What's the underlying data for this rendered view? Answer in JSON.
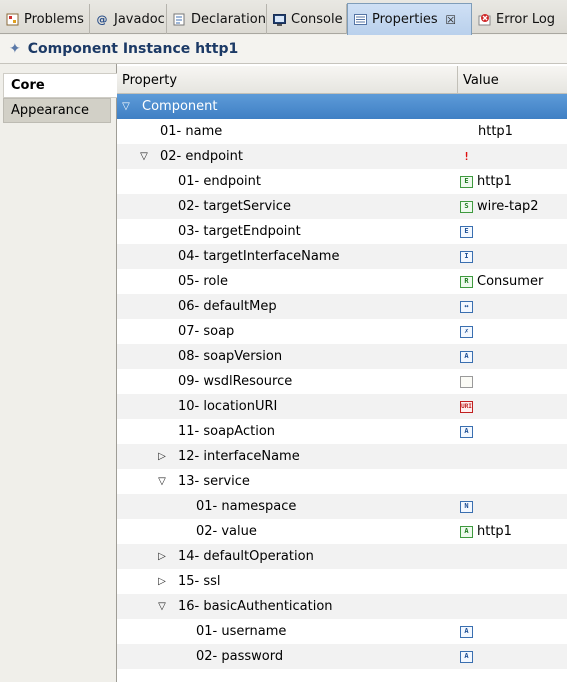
{
  "tabs": [
    {
      "label": "Problems",
      "icon": "problems-icon",
      "active": false
    },
    {
      "label": "Javadoc",
      "icon": "javadoc-icon",
      "active": false
    },
    {
      "label": "Declaration",
      "icon": "declaration-icon",
      "active": false
    },
    {
      "label": "Console",
      "icon": "console-icon",
      "active": false
    },
    {
      "label": "Properties",
      "icon": "properties-icon",
      "active": true
    },
    {
      "label": "Error Log",
      "icon": "error-log-icon",
      "active": false
    }
  ],
  "title": "Component Instance http1",
  "categories": [
    "Core",
    "Appearance"
  ],
  "columns": {
    "property": "Property",
    "value": "Value"
  },
  "rows": [
    {
      "label": "Component",
      "value": "",
      "icon": ""
    },
    {
      "label": "01- name",
      "value": "http1",
      "icon": ""
    },
    {
      "label": "02- endpoint",
      "value": "",
      "icon": "error-marker-icon"
    },
    {
      "label": "01- endpoint",
      "value": "http1",
      "icon": "endpoint-ref-icon"
    },
    {
      "label": "02- targetService",
      "value": "wire-tap2",
      "icon": "service-ref-icon"
    },
    {
      "label": "03- targetEndpoint",
      "value": "",
      "icon": "endpoint-ref-icon"
    },
    {
      "label": "04- targetInterfaceName",
      "value": "",
      "icon": "interface-icon"
    },
    {
      "label": "05- role",
      "value": "Consumer",
      "icon": "role-icon"
    },
    {
      "label": "06- defaultMep",
      "value": "",
      "icon": "mep-icon"
    },
    {
      "label": "07- soap",
      "value": "",
      "icon": "boolean-icon"
    },
    {
      "label": "08- soapVersion",
      "value": "",
      "icon": "text-attribute-icon"
    },
    {
      "label": "09- wsdlResource",
      "value": "",
      "icon": "document-icon"
    },
    {
      "label": "10- locationURI",
      "value": "",
      "icon": "uri-icon"
    },
    {
      "label": "11- soapAction",
      "value": "",
      "icon": "text-attribute-icon"
    },
    {
      "label": "12- interfaceName",
      "value": "",
      "icon": ""
    },
    {
      "label": "13- service",
      "value": "",
      "icon": ""
    },
    {
      "label": "01- namespace",
      "value": "",
      "icon": "namespace-icon"
    },
    {
      "label": "02- value",
      "value": "http1",
      "icon": "text-value-icon"
    },
    {
      "label": "14- defaultOperation",
      "value": "",
      "icon": ""
    },
    {
      "label": "15- ssl",
      "value": "",
      "icon": ""
    },
    {
      "label": "16- basicAuthentication",
      "value": "",
      "icon": ""
    },
    {
      "label": "01- username",
      "value": "",
      "icon": "text-attribute-icon"
    },
    {
      "label": "02- password",
      "value": "",
      "icon": "text-attribute-icon"
    }
  ]
}
